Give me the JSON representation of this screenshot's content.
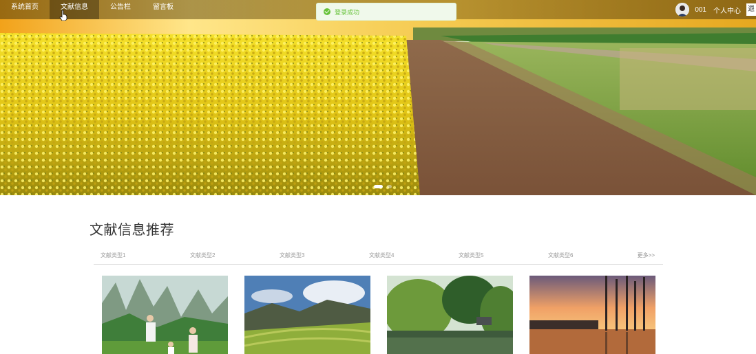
{
  "nav": {
    "items": [
      "系统首页",
      "文献信息",
      "公告栏",
      "留言板"
    ],
    "active": "文献信息"
  },
  "user": {
    "name": "001",
    "center": "个人中心",
    "logout": "退"
  },
  "toast": {
    "message": "登录成功",
    "color": "#67c23a"
  },
  "section": {
    "title": "文献信息推荐",
    "tabs": [
      "文献类型1",
      "文献类型2",
      "文献类型3",
      "文献类型4",
      "文献类型5",
      "文献类型6"
    ],
    "more": "更多>>"
  },
  "carousel": {
    "slides": 2,
    "active_slide": 1
  },
  "cards": [
    {
      "image": "karst-mountain-family"
    },
    {
      "image": "valley-rice-terraces"
    },
    {
      "image": "willow-pond"
    },
    {
      "image": "sunset-trees-reflection"
    }
  ],
  "icons": {
    "cursor": "hand-pointer-icon",
    "success": "check-circle-icon"
  }
}
